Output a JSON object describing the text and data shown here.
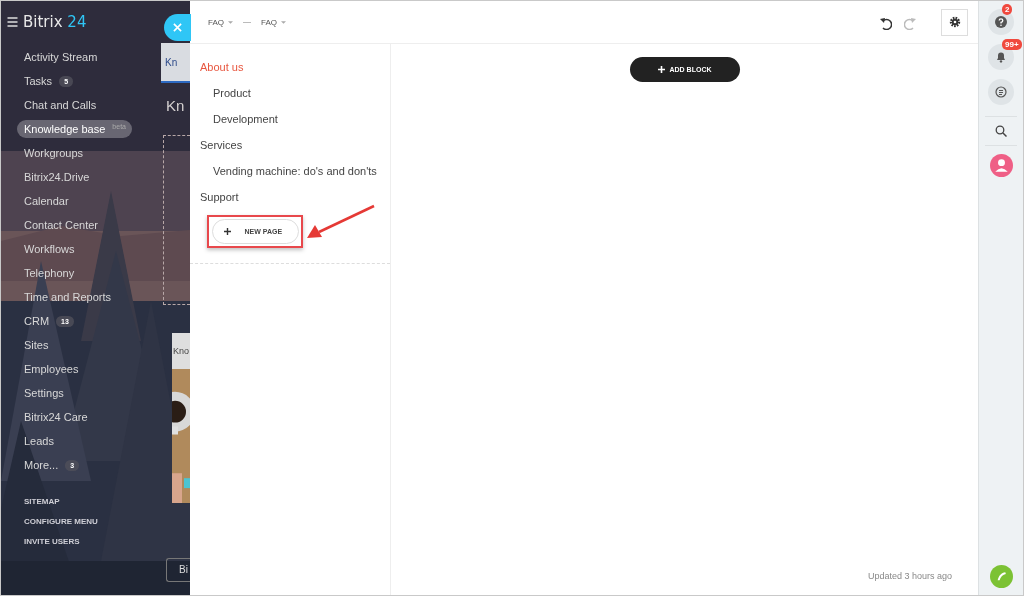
{
  "sidebar": {
    "logo": {
      "name": "Bitrix",
      "number": "24"
    },
    "items": [
      {
        "label": "Activity Stream",
        "selected": false
      },
      {
        "label": "Tasks",
        "counter": "5",
        "selected": false
      },
      {
        "label": "Chat and Calls",
        "selected": false
      },
      {
        "label": "Knowledge base",
        "tag": "beta",
        "selected": true
      },
      {
        "label": "Workgroups",
        "selected": false
      },
      {
        "label": "Bitrix24.Drive",
        "selected": false
      },
      {
        "label": "Calendar",
        "selected": false
      },
      {
        "label": "Contact Center",
        "selected": false
      },
      {
        "label": "Workflows",
        "selected": false
      },
      {
        "label": "Telephony",
        "selected": false
      },
      {
        "label": "Time and Reports",
        "selected": false
      },
      {
        "label": "CRM",
        "counter": "13",
        "selected": false
      },
      {
        "label": "Sites",
        "selected": false
      },
      {
        "label": "Employees",
        "selected": false
      },
      {
        "label": "Settings",
        "selected": false
      },
      {
        "label": "Bitrix24 Care",
        "selected": false
      },
      {
        "label": "Leads",
        "selected": false
      },
      {
        "label": "More...",
        "counter": "3",
        "selected": false
      }
    ],
    "links": [
      "SITEMAP",
      "CONFIGURE MENU",
      "INVITE USERS"
    ]
  },
  "background_page": {
    "tab": "Kn",
    "title": "Kn",
    "card_title": "Kno",
    "button": "Bi"
  },
  "panel": {
    "breadcrumb": [
      "FAQ",
      "FAQ"
    ],
    "menu": [
      {
        "label": "About us",
        "selected": true,
        "children": [
          {
            "label": "Product",
            "selected": false
          },
          {
            "label": "Development",
            "selected": false
          }
        ]
      },
      {
        "label": "Services",
        "selected": false,
        "children": [
          {
            "label": "Vending machine: do's and don'ts",
            "selected": false
          }
        ]
      },
      {
        "label": "Support",
        "selected": false
      }
    ],
    "new_page_button": "NEW PAGE",
    "add_block_button": "ADD BLOCK",
    "status": "Updated 3 hours ago"
  },
  "right_bar": {
    "help_badge": "2",
    "notifications_badge": "99+"
  }
}
